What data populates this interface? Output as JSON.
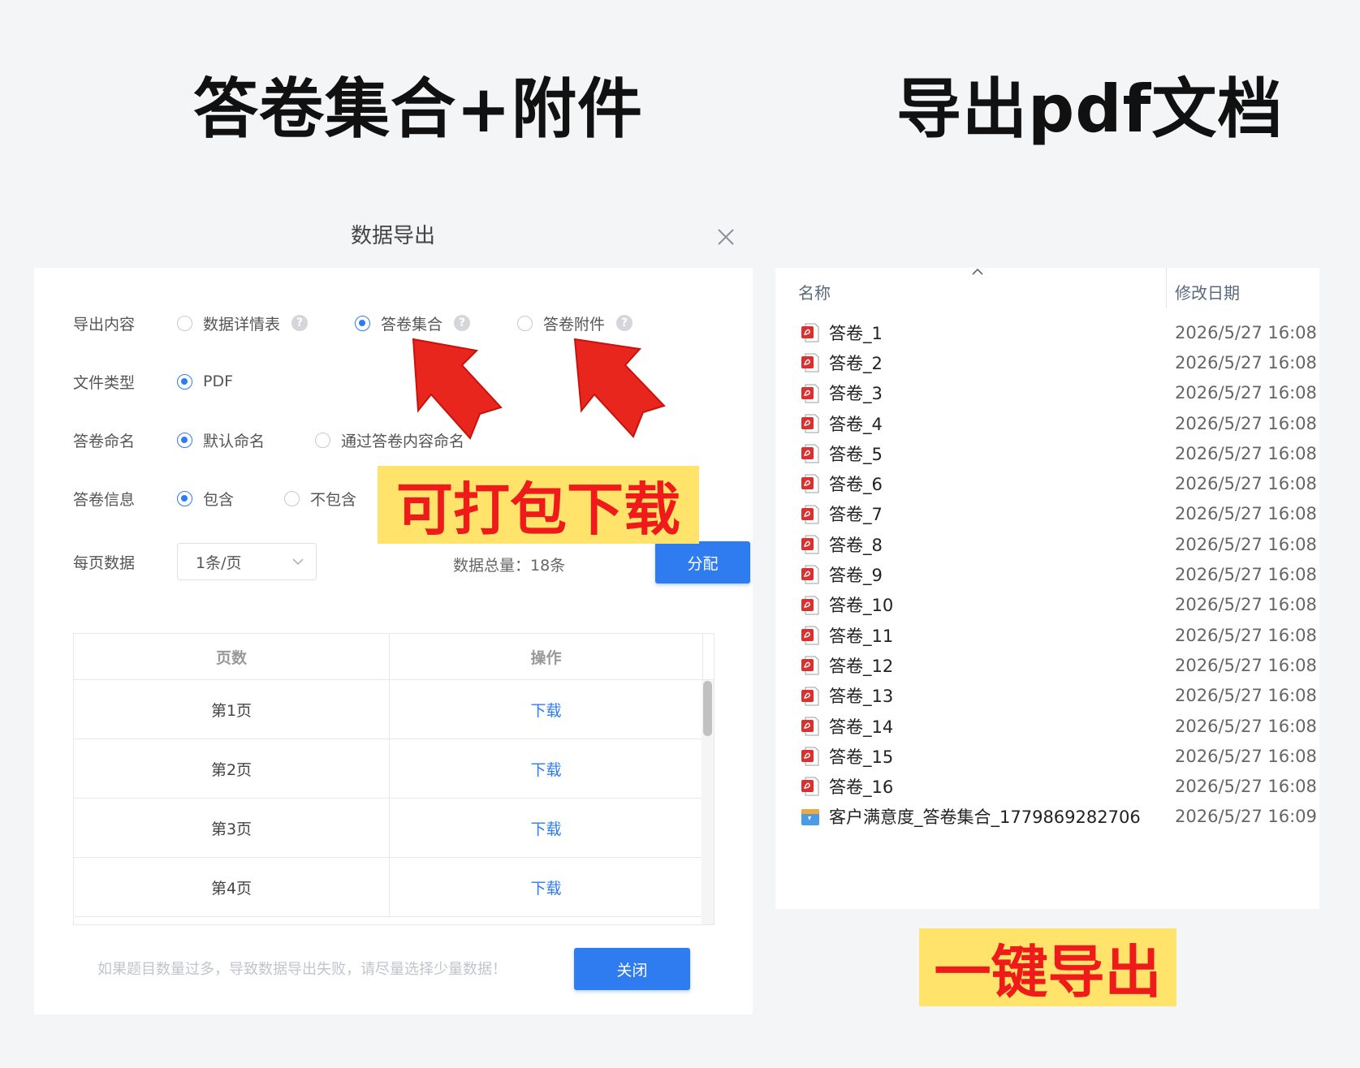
{
  "headlines": {
    "left": "答卷集合+附件",
    "right": "导出pdf文档"
  },
  "dialog": {
    "title": "数据导出",
    "close_icon": "close-icon",
    "export_content": {
      "label": "导出内容",
      "options": [
        "数据详情表",
        "答卷集合",
        "答卷附件"
      ],
      "selected": "答卷集合",
      "help_icon": "question-circle-icon"
    },
    "file_type": {
      "label": "文件类型",
      "option": "PDF",
      "selected": "PDF"
    },
    "naming": {
      "label": "答卷命名",
      "options": [
        "默认命名",
        "通过答卷内容命名"
      ],
      "selected": "默认命名"
    },
    "info": {
      "label": "答卷信息",
      "options": [
        "包含",
        "不包含"
      ],
      "selected": "包含"
    },
    "per_page": {
      "label": "每页数据",
      "value": "1条/页",
      "dropdown_icon": "chevron-down-icon"
    },
    "total": "数据总量：18条",
    "assign_button": "分配",
    "table": {
      "headers": [
        "页数",
        "操作"
      ],
      "rows": [
        {
          "page": "第1页",
          "action": "下载"
        },
        {
          "page": "第2页",
          "action": "下载"
        },
        {
          "page": "第3页",
          "action": "下载"
        },
        {
          "page": "第4页",
          "action": "下载"
        }
      ]
    },
    "hint": "如果题目数量过多，导致数据导出失败，请尽量选择少量数据！",
    "close_button": "关闭"
  },
  "badges": {
    "pack": "可打包下载",
    "export": "一键导出"
  },
  "explorer": {
    "columns": {
      "name": "名称",
      "date": "修改日期"
    },
    "files": [
      {
        "name": "答卷_1",
        "date": "2026/5/27 16:08",
        "icon": "pdf-file-icon"
      },
      {
        "name": "答卷_2",
        "date": "2026/5/27 16:08",
        "icon": "pdf-file-icon"
      },
      {
        "name": "答卷_3",
        "date": "2026/5/27 16:08",
        "icon": "pdf-file-icon"
      },
      {
        "name": "答卷_4",
        "date": "2026/5/27 16:08",
        "icon": "pdf-file-icon"
      },
      {
        "name": "答卷_5",
        "date": "2026/5/27 16:08",
        "icon": "pdf-file-icon"
      },
      {
        "name": "答卷_6",
        "date": "2026/5/27 16:08",
        "icon": "pdf-file-icon"
      },
      {
        "name": "答卷_7",
        "date": "2026/5/27 16:08",
        "icon": "pdf-file-icon"
      },
      {
        "name": "答卷_8",
        "date": "2026/5/27 16:08",
        "icon": "pdf-file-icon"
      },
      {
        "name": "答卷_9",
        "date": "2026/5/27 16:08",
        "icon": "pdf-file-icon"
      },
      {
        "name": "答卷_10",
        "date": "2026/5/27 16:08",
        "icon": "pdf-file-icon"
      },
      {
        "name": "答卷_11",
        "date": "2026/5/27 16:08",
        "icon": "pdf-file-icon"
      },
      {
        "name": "答卷_12",
        "date": "2026/5/27 16:08",
        "icon": "pdf-file-icon"
      },
      {
        "name": "答卷_13",
        "date": "2026/5/27 16:08",
        "icon": "pdf-file-icon"
      },
      {
        "name": "答卷_14",
        "date": "2026/5/27 16:08",
        "icon": "pdf-file-icon"
      },
      {
        "name": "答卷_15",
        "date": "2026/5/27 16:08",
        "icon": "pdf-file-icon"
      },
      {
        "name": "答卷_16",
        "date": "2026/5/27 16:08",
        "icon": "pdf-file-icon"
      },
      {
        "name": "客户满意度_答卷集合_1779869282706",
        "date": "2026/5/27 16:09",
        "icon": "image-file-icon"
      }
    ]
  },
  "colors": {
    "accent": "#2f7bf0",
    "badge_bg": "#ffe36b",
    "badge_text": "#ef1b1b",
    "arrow": "#e8261d",
    "pdf_icon": "#d8312f"
  }
}
